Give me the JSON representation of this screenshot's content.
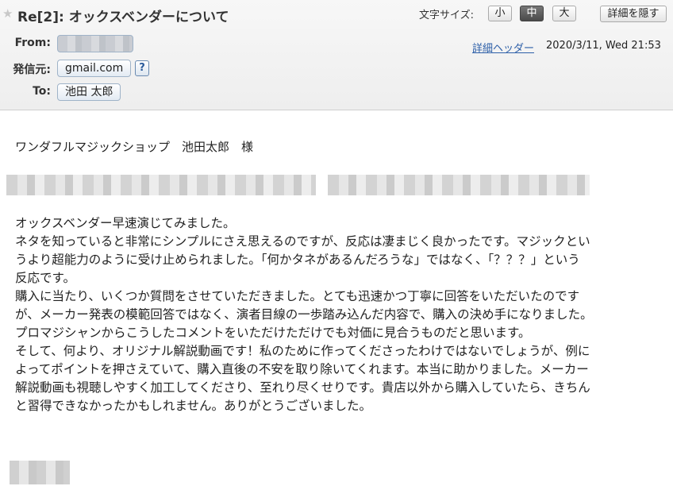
{
  "email": {
    "subject": "Re[2]: オックスベンダーについて",
    "font_size_label": "文字サイズ:",
    "font_size_options": [
      "小",
      "中",
      "大"
    ],
    "font_size_selected": "中",
    "hide_details_label": "詳細を隠す",
    "from_label": "From:",
    "sender_label": "発信元:",
    "sender_value": "gmail.com",
    "help_label": "?",
    "to_label": "To:",
    "to_value": "池田 太郎",
    "detail_header_link": "詳細ヘッダー",
    "date": "2020/3/11, Wed 21:53"
  },
  "message": {
    "greeting": "ワンダフルマジックショップ　池田太郎　様",
    "lines": [
      "オックスベンダー早速演じてみました。",
      "ネタを知っていると非常にシンプルにさえ思えるのですが、反応は凄まじく良かったです。マジックとい",
      "うより超能力のように受け止められました。「何かタネがあるんだろうな」ではなく、「？？？」という",
      "反応です。",
      "購入に当たり、いくつか質問をさせていただきました。とても迅速かつ丁寧に回答をいただいたのです",
      "が、メーカー発表の模範回答ではなく、演者目線の一歩踏み込んだ内容で、購入の決め手になりました。",
      "プロマジシャンからこうしたコメントをいただけただけでも対価に見合うものだと思います。",
      "そして、何より、オリジナル解説動画です！私のために作ってくださったわけではないでしょうが、例に",
      "よってポイントを押さえていて、購入直後の不安を取り除いてくれます。本当に助かりました。メーカー",
      "解説動画も視聴しやすく加工してくださり、至れり尽くせりです。貴店以外から購入していたら、きちん",
      "と習得できなかったかもしれません。ありがとうございました。"
    ]
  },
  "icons": {
    "star": "star-icon"
  }
}
